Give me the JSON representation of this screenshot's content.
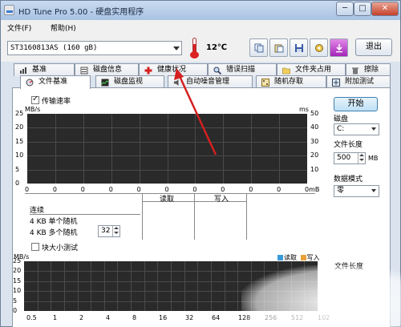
{
  "window": {
    "title": "HD Tune Pro 5.00 - 硬盘实用程序",
    "min": "─",
    "max": "□",
    "close": "✕"
  },
  "menu": [
    "文件(F)",
    "帮助(H)"
  ],
  "toolbar": {
    "drive": "ST3160813AS (160 gB)",
    "temperature": "12℃",
    "exit_label": "退出"
  },
  "tabs_row1": [
    "基准",
    "磁盘信息",
    "健康状况",
    "错误扫描",
    "文件夹占用",
    "擦除"
  ],
  "tabs_row2": [
    "文件基准",
    "磁盘监视",
    "自动噪音管理",
    "随机存取",
    "附加测试"
  ],
  "top_graph": {
    "checkbox_label": "传输速率",
    "left_unit": "MB/s",
    "right_unit": "ms",
    "left_ticks": [
      "25",
      "20",
      "15",
      "10",
      "5",
      "0"
    ],
    "right_ticks": [
      "50",
      "40",
      "30",
      "20",
      "10",
      ""
    ],
    "x_ticks": [
      "0",
      "0",
      "0",
      "0",
      "0",
      "0",
      "0",
      "0",
      "0",
      "0",
      "0mB"
    ]
  },
  "results": {
    "col_read": "读取",
    "col_write": "写入",
    "section": "连续",
    "row_4kb_single": "4 KB 单个随机",
    "row_4kb_multi": "4 KB 多个随机",
    "queue_depth": "32"
  },
  "side": {
    "start": "开始",
    "disk_label": "磁盘",
    "disk_value": "C:",
    "file_len_label": "文件长度",
    "file_len_value": "500",
    "file_len_unit": "MB",
    "data_mode_label": "数据模式",
    "data_mode_value": "零",
    "file_len_label2": "文件长度"
  },
  "bottom_graph": {
    "checkbox_label": "块大小测试",
    "unit": "MB/s",
    "legend_read": "读取",
    "legend_write": "写入",
    "y_ticks": [
      "25",
      "20",
      "15",
      "10",
      "5",
      "0"
    ],
    "x_ticks": [
      "0.5",
      "1",
      "2",
      "4",
      "8",
      "16",
      "32",
      "64",
      "128",
      "256",
      "512",
      "102"
    ]
  },
  "colors": {
    "graph_bg": "#2a2a2a",
    "grid": "#4a4a4a",
    "read": "#3a9ad9",
    "write": "#e8a13a",
    "arrow": "#d42020"
  }
}
